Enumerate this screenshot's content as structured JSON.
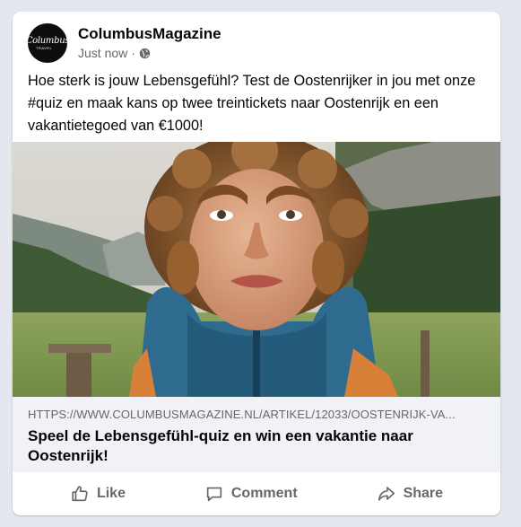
{
  "post": {
    "page_name": "ColumbusMagazine",
    "avatar_logo": "Columbus",
    "avatar_logo_sub": "TRAVEL",
    "timestamp": "Just now",
    "separator": "·",
    "privacy_icon": "globe-icon",
    "text": "Hoe sterk is jouw Lebensgefühl? Test de Oostenrijker in jou met onze #quiz en maak kans op twee treintickets naar Oostenrijk en een vakantietegoed van €1000!"
  },
  "link_preview": {
    "url": "HTTPS://WWW.COLUMBUSMAGAZINE.NL/ARTIKEL/12033/OOSTENRIJK-VA...",
    "title": "Speel de Lebensgefühl-quiz en win een vakantie naar Oostenrijk!"
  },
  "actions": {
    "like_label": "Like",
    "like_icon": "thumbs-up-icon",
    "comment_label": "Comment",
    "comment_icon": "speech-bubble-icon",
    "share_label": "Share",
    "share_icon": "share-arrow-icon"
  },
  "colors": {
    "background": "#e4e7ee",
    "card": "#ffffff",
    "link_box": "#f0f2f5",
    "secondary_text": "#65676b",
    "primary_text": "#050505"
  }
}
